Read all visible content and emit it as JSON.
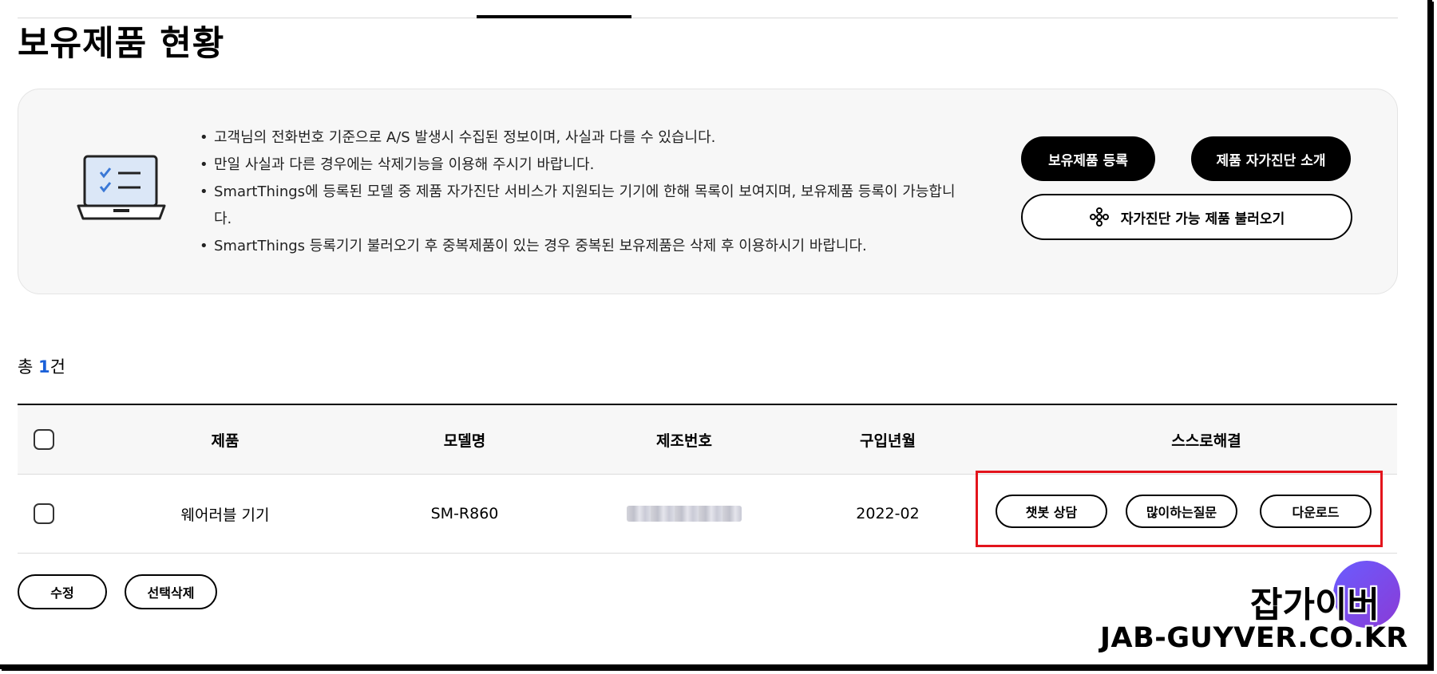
{
  "page": {
    "title": "보유제품 현황"
  },
  "notice": {
    "items": [
      "고객님의 전화번호 기준으로 A/S 발생시 수집된 정보이며, 사실과 다를 수 있습니다.",
      "만일 사실과 다른 경우에는 삭제기능을 이용해 주시기 바랍니다.",
      "SmartThings에 등록된 모델 중 제품 자가진단 서비스가 지원되는 기기에 한해 목록이 보여지며, 보유제품 등록이 가능합니다.",
      "SmartThings 등록기기 불러오기 후 중복제품이 있는 경우 중복된 보유제품은 삭제 후 이용하시기 바랍니다."
    ],
    "icon": "laptop-checklist-icon"
  },
  "actions": {
    "register": "보유제품 등록",
    "intro": "제품 자가진단 소개",
    "import": "자가진단 가능 제품 불러오기",
    "import_icon": "smartthings-icon"
  },
  "summary": {
    "prefix": "총 ",
    "count": "1",
    "suffix": "건"
  },
  "table": {
    "headers": {
      "product": "제품",
      "model": "모델명",
      "serial": "제조번호",
      "date": "구입년월",
      "self": "스스로해결"
    },
    "rows": [
      {
        "product": "웨어러블 기기",
        "model": "SM-R860",
        "date": "2022-02",
        "serial_blurred": true,
        "self_buttons": [
          "챗봇 상담",
          "많이하는질문",
          "다운로드"
        ]
      }
    ]
  },
  "bottom": {
    "edit": "수정",
    "delete": "선택삭제"
  },
  "watermark": {
    "title": "잡가이버",
    "url": "JAB-GUYVER.CO.KR"
  },
  "colors": {
    "accent": "#1a60d8",
    "highlight": "#e3141c",
    "fab": "#7b4fe8"
  }
}
